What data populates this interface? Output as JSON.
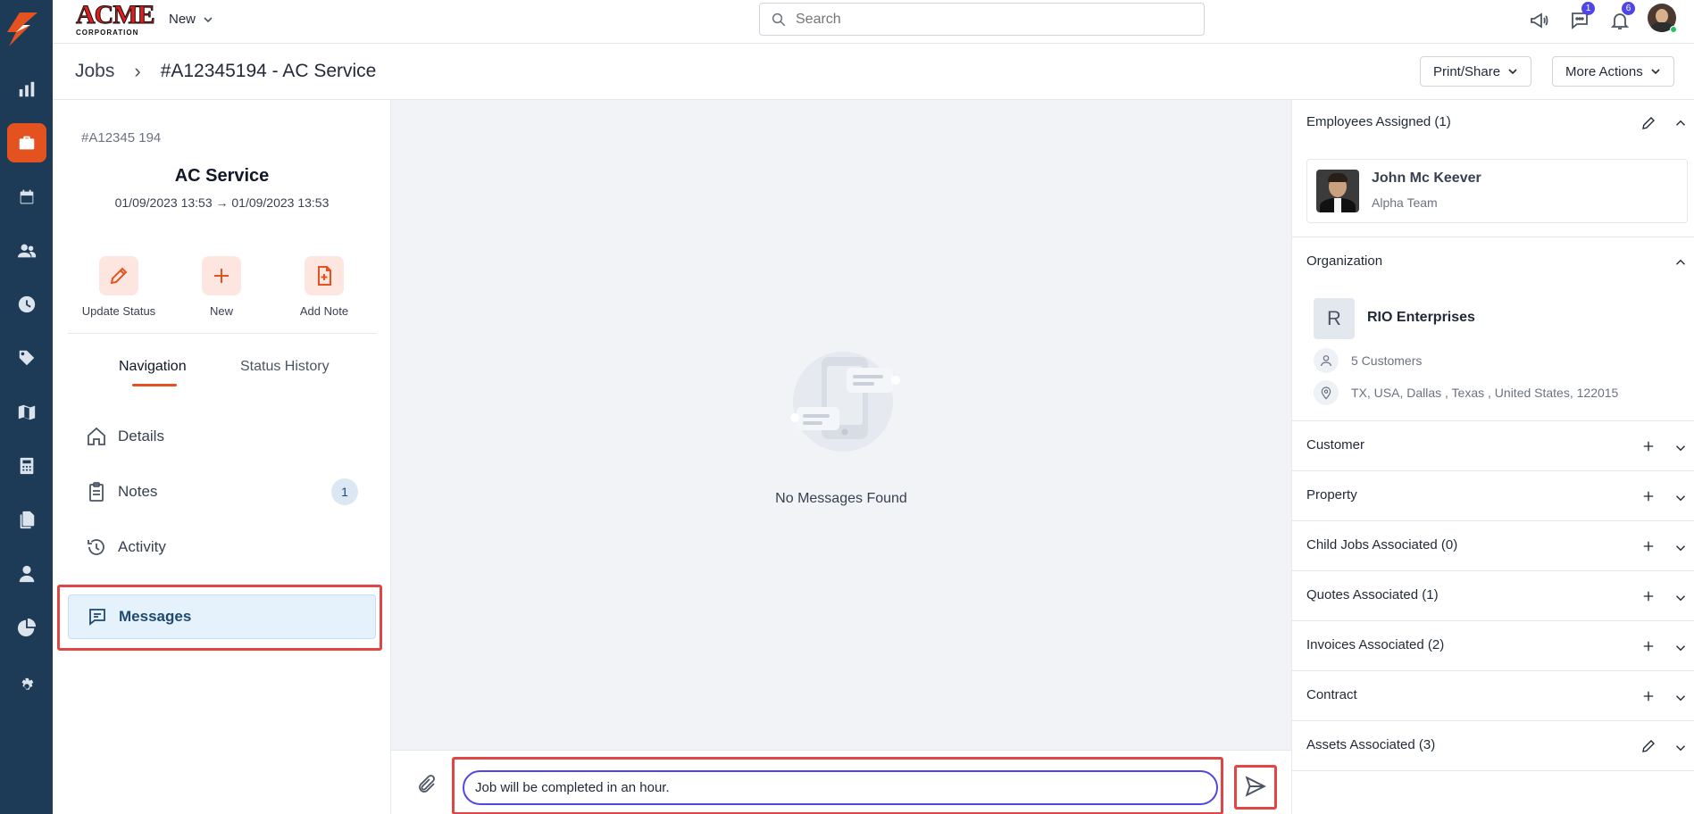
{
  "brand": {
    "name": "ACME",
    "sub": "CORPORATION"
  },
  "topbar": {
    "new_label": "New",
    "search_placeholder": "Search",
    "chat_badge": "1",
    "notif_badge": "6"
  },
  "header": {
    "breadcrumb_root": "Jobs",
    "breadcrumb_sep": "›",
    "title": "#A12345194 - AC Service",
    "print_share": "Print/Share",
    "more_actions": "More Actions"
  },
  "job": {
    "number": "#A12345 194",
    "title": "AC Service",
    "dates": "01/09/2023 13:53 → 01/09/2023 13:53",
    "actions": [
      {
        "label": "Update Status",
        "icon": "pencil-icon"
      },
      {
        "label": "New",
        "icon": "plus-icon"
      },
      {
        "label": "Add Note",
        "icon": "add-note-icon"
      }
    ]
  },
  "left_tabs": {
    "navigation": "Navigation",
    "status_history": "Status History"
  },
  "nav": {
    "items": [
      {
        "label": "Details",
        "icon": "home-icon"
      },
      {
        "label": "Notes",
        "icon": "clipboard-icon",
        "count": "1"
      },
      {
        "label": "Activity",
        "icon": "history-icon"
      },
      {
        "label": "Messages",
        "icon": "message-icon"
      }
    ]
  },
  "messages": {
    "empty_text": "No Messages Found",
    "input_value": "Job will be completed in an hour."
  },
  "right": {
    "employees_title": "Employees Assigned (1)",
    "employee": {
      "name": "John Mc Keever",
      "team": "Alpha Team"
    },
    "organization_title": "Organization",
    "org": {
      "letter": "R",
      "name": "RIO Enterprises",
      "customers": "5 Customers",
      "address": "TX, USA, Dallas , Texas , United States, 122015"
    },
    "sections": [
      "Customer",
      "Property",
      "Child Jobs Associated (0)",
      "Quotes Associated (1)",
      "Invoices Associated (2)",
      "Contract",
      "Assets Associated (3)"
    ]
  },
  "colors": {
    "accent": "#e4531f",
    "rail": "#1d3a57",
    "focus": "#4f46e5",
    "highlight": "#e04646"
  }
}
